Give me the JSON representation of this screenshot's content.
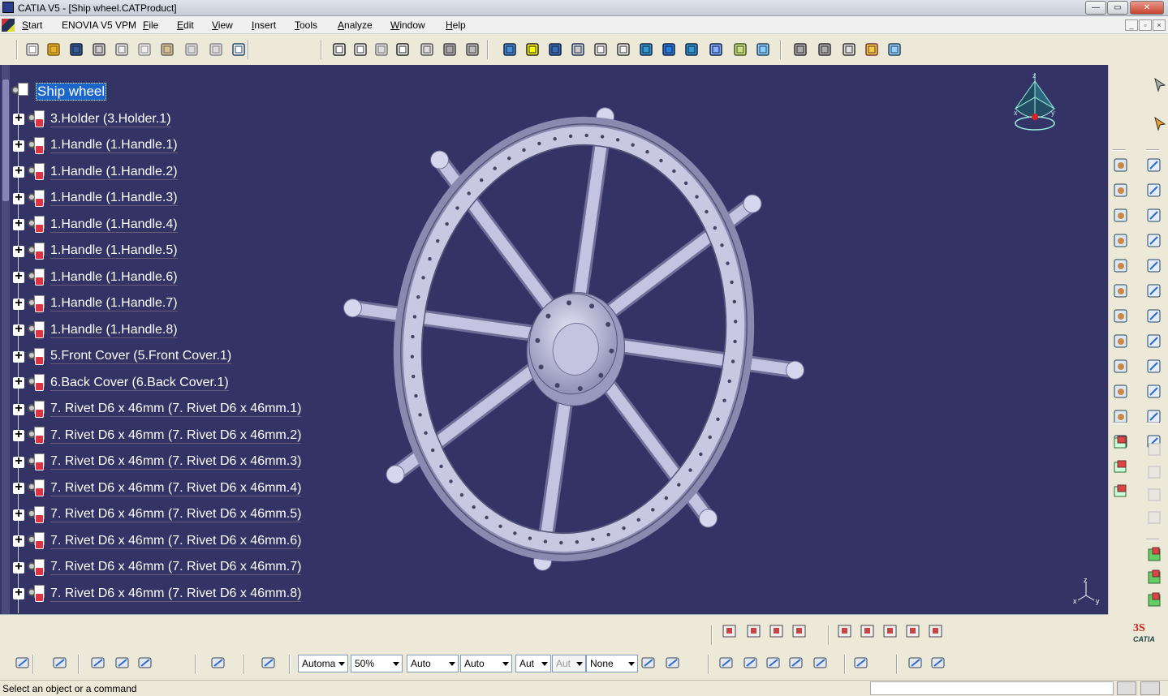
{
  "window": {
    "title": "CATIA V5 - [Ship wheel.CATProduct]",
    "controls": {
      "minimize": "—",
      "restore": "▭",
      "close": "✕"
    }
  },
  "menubar": {
    "items": [
      {
        "label": "Start",
        "u": "S"
      },
      {
        "label": "ENOVIA V5 VPM"
      },
      {
        "label": "File",
        "u": "F"
      },
      {
        "label": "Edit",
        "u": "E"
      },
      {
        "label": "View",
        "u": "V"
      },
      {
        "label": "Insert",
        "u": "I"
      },
      {
        "label": "Tools",
        "u": "T"
      },
      {
        "label": "Analyze",
        "u": "A"
      },
      {
        "label": "Window",
        "u": "W"
      },
      {
        "label": "Help",
        "u": "H"
      }
    ],
    "mdi_controls": {
      "minimize": "_",
      "restore": "▫",
      "close": "×"
    }
  },
  "tree": {
    "root": "Ship wheel",
    "nodes": [
      "3.Holder (3.Holder.1)",
      "1.Handle (1.Handle.1)",
      "1.Handle (1.Handle.2)",
      "1.Handle (1.Handle.3)",
      "1.Handle (1.Handle.4)",
      "1.Handle (1.Handle.5)",
      "1.Handle (1.Handle.6)",
      "1.Handle (1.Handle.7)",
      "1.Handle (1.Handle.8)",
      "5.Front Cover (5.Front Cover.1)",
      "6.Back Cover (6.Back Cover.1)",
      "7. Rivet D6 x 46mm (7. Rivet D6 x 46mm.1)",
      "7. Rivet D6 x 46mm (7. Rivet D6 x 46mm.2)",
      "7. Rivet D6 x 46mm (7. Rivet D6 x 46mm.3)",
      "7. Rivet D6 x 46mm (7. Rivet D6 x 46mm.4)",
      "7. Rivet D6 x 46mm (7. Rivet D6 x 46mm.5)",
      "7. Rivet D6 x 46mm (7. Rivet D6 x 46mm.6)",
      "7. Rivet D6 x 46mm (7. Rivet D6 x 46mm.7)",
      "7. Rivet D6 x 46mm (7. Rivet D6 x 46mm.8)"
    ]
  },
  "compass": {
    "x": "x",
    "y": "y",
    "z": "z"
  },
  "mini_axis": {
    "x": "x",
    "y": "y",
    "z": "z"
  },
  "bottom_toolbar": {
    "selects": [
      {
        "value": "Automa",
        "disabled": false
      },
      {
        "value": "50%",
        "disabled": false
      },
      {
        "value": "Auto",
        "disabled": false
      },
      {
        "value": "Auto",
        "disabled": false
      },
      {
        "value": "Aut",
        "disabled": false
      },
      {
        "value": "Aut",
        "disabled": true
      },
      {
        "value": "None",
        "disabled": false
      }
    ],
    "brand": "CATIA"
  },
  "status": {
    "message": "Select an object or a command"
  },
  "colors": {
    "viewport_bg": "#333366",
    "selection": "#1a66cc",
    "wheel": "#b8b8d8"
  }
}
